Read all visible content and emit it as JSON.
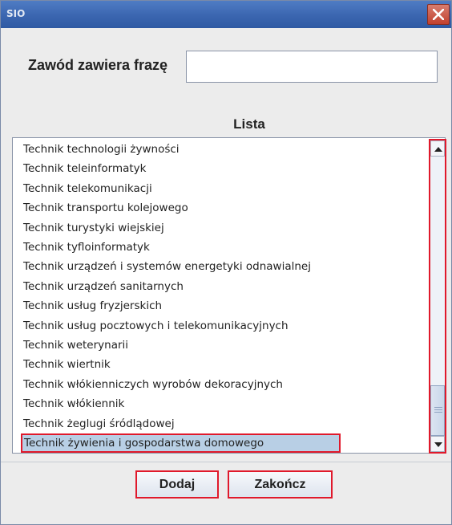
{
  "window": {
    "title_logo": "SIO"
  },
  "search": {
    "label": "Zawód zawiera frazę",
    "value": "",
    "placeholder": ""
  },
  "list": {
    "title": "Lista",
    "items": [
      "Technik technologii żywności",
      "Technik teleinformatyk",
      "Technik telekomunikacji",
      "Technik transportu kolejowego",
      "Technik turystyki wiejskiej",
      "Technik tyfloinformatyk",
      "Technik urządzeń i systemów energetyki odnawialnej",
      "Technik urządzeń sanitarnych",
      "Technik usług fryzjerskich",
      "Technik usług pocztowych i telekomunikacyjnych",
      "Technik weterynarii",
      "Technik wiertnik",
      "Technik włókienniczych wyrobów dekoracyjnych",
      "Technik włókiennik",
      "Technik żeglugi śródlądowej",
      "Technik żywienia i gospodarstwa domowego"
    ],
    "selected_index": 15
  },
  "buttons": {
    "add_label": "Dodaj",
    "close_label": "Zakończ"
  },
  "colors": {
    "titlebar": "#3b66b0",
    "highlight_border": "#e0192b",
    "selection_background": "#b8cfe5"
  },
  "icons": {
    "close": "close-icon",
    "scroll_up": "arrow-up-icon",
    "scroll_down": "arrow-down-icon"
  }
}
